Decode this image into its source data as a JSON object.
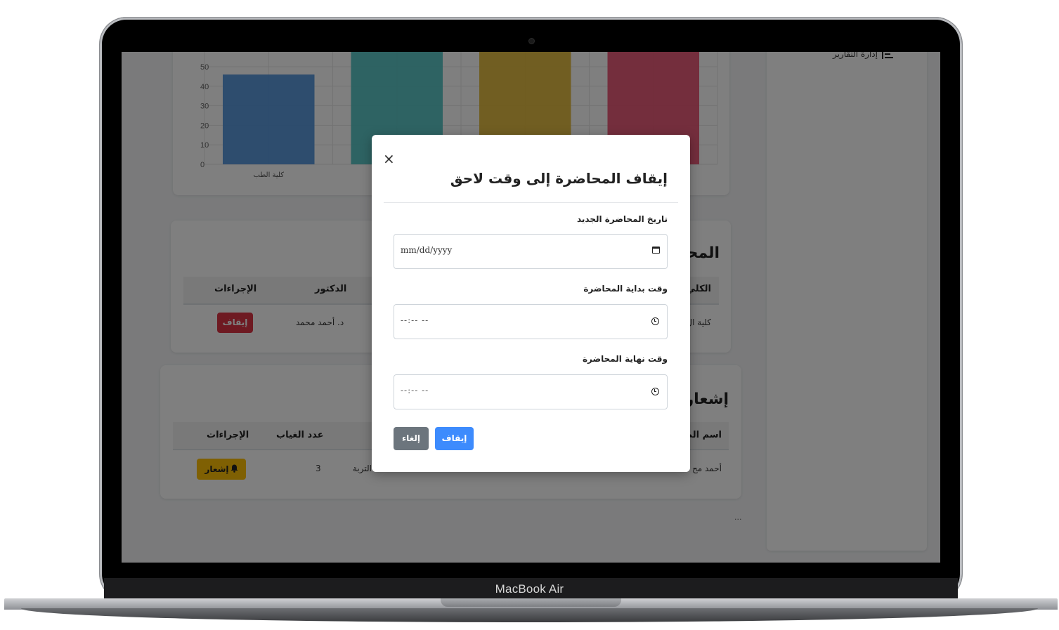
{
  "device": {
    "brand": "MacBook Air"
  },
  "sidebar": {
    "reports_label": "إدارة التقارير",
    "reports_icon": "list-icon"
  },
  "chart_data": {
    "type": "bar",
    "categories": [
      "كلية الطب",
      "",
      "",
      ""
    ],
    "values": [
      46,
      60,
      59,
      59
    ],
    "colors": [
      "#4a90d9",
      "#4bc0c0",
      "#e0b530",
      "#e54b6b"
    ],
    "yticks": [
      0,
      10,
      20,
      30,
      40,
      50
    ],
    "grid": true,
    "title": "",
    "xlabel": "",
    "ylabel": ""
  },
  "lectures": {
    "title": "المحا",
    "headers": {
      "college": "الكلي",
      "doctor": "الدكتور",
      "actions": "الإجراءات"
    },
    "row": {
      "college": "كلية ال",
      "doctor": "د. أحمد محمد",
      "action": "إيقاف"
    }
  },
  "notifications": {
    "title": "إشعار",
    "headers": {
      "student": "اسم الط",
      "absences": "عدد الغياب",
      "actions": "الإجراءات"
    },
    "row": {
      "student": "أحمد مح",
      "college_fragment": "التربة",
      "absences": "3",
      "action": "إشعار",
      "action_icon": "bell-icon"
    }
  },
  "footer": {
    "ellipsis": "..."
  },
  "modal": {
    "title": "إيقاف المحاضرة إلى وقت لاحق",
    "close_symbol": "×",
    "date_label": "تاريخ المحاضرة الجديد",
    "date_placeholder": "mm/dd/yyyy",
    "start_label": "وقت بداية المحاضرة",
    "start_placeholder": "--:-- --",
    "end_label": "وقت نهاية المحاضرة",
    "end_placeholder": "--:-- --",
    "submit_label": "إيقاف",
    "cancel_label": "إلغاء"
  }
}
